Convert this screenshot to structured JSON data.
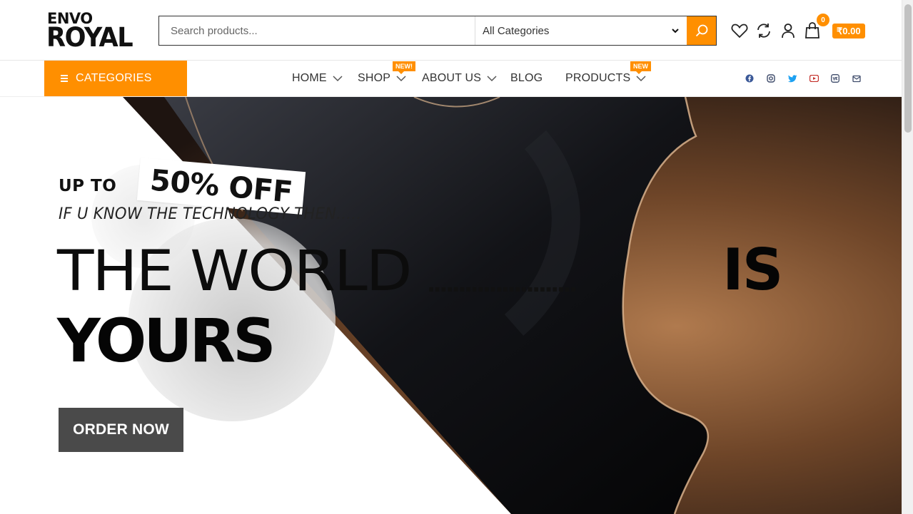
{
  "header": {
    "logo_line1": "ENVO",
    "logo_line2": "ROYAL",
    "search_placeholder": "Search products...",
    "category_selected": "All Categories",
    "cart_count": "0",
    "cart_total": "₹0.00",
    "icons": [
      "search-icon",
      "heart-icon",
      "compare-icon",
      "user-icon",
      "bag-icon"
    ]
  },
  "nav": {
    "categories_label": "CATEGORIES",
    "items": [
      {
        "label": "HOME",
        "dropdown": true
      },
      {
        "label": "SHOP",
        "dropdown": true,
        "badge": "NEW!"
      },
      {
        "label": "ABOUT US",
        "dropdown": true
      },
      {
        "label": "BLOG",
        "dropdown": false
      },
      {
        "label": "PRODUCTS",
        "dropdown": true,
        "badge": "NEW"
      }
    ],
    "social": [
      "facebook-icon",
      "instagram-icon",
      "twitter-icon",
      "youtube-icon",
      "vk-icon",
      "email-icon"
    ]
  },
  "hero": {
    "up_to": "UP TO",
    "discount": "50% OFF",
    "tagline": "IF U KNOW THE TECHNOLOGY THEN.....",
    "headline_part1": "THE WORLD",
    "headline_dots": "........................",
    "headline_part2": "IS",
    "headline_part3": "YOURS",
    "cta": "ORDER NOW"
  },
  "colors": {
    "accent": "#ff8f00",
    "dark": "#111111",
    "button": "#4a4a4a"
  }
}
